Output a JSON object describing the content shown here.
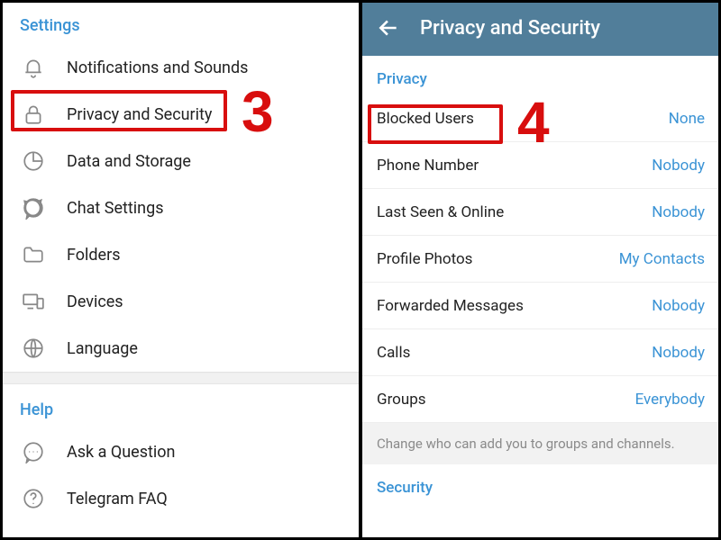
{
  "left": {
    "settings_title": "Settings",
    "items": [
      {
        "label": "Notifications and Sounds"
      },
      {
        "label": "Privacy and Security"
      },
      {
        "label": "Data and Storage"
      },
      {
        "label": "Chat Settings"
      },
      {
        "label": "Folders"
      },
      {
        "label": "Devices"
      },
      {
        "label": "Language"
      }
    ],
    "help_title": "Help",
    "help_items": [
      {
        "label": "Ask a Question"
      },
      {
        "label": "Telegram FAQ"
      }
    ]
  },
  "right": {
    "appbar_title": "Privacy and Security",
    "privacy_title": "Privacy",
    "privacy_items": [
      {
        "label": "Blocked Users",
        "value": "None"
      },
      {
        "label": "Phone Number",
        "value": "Nobody"
      },
      {
        "label": "Last Seen & Online",
        "value": "Nobody"
      },
      {
        "label": "Profile Photos",
        "value": "My Contacts"
      },
      {
        "label": "Forwarded Messages",
        "value": "Nobody"
      },
      {
        "label": "Calls",
        "value": "Nobody"
      },
      {
        "label": "Groups",
        "value": "Everybody"
      }
    ],
    "hint": "Change who can add you to groups and channels.",
    "security_title": "Security"
  },
  "annotations": {
    "step3": "3",
    "step4": "4"
  }
}
